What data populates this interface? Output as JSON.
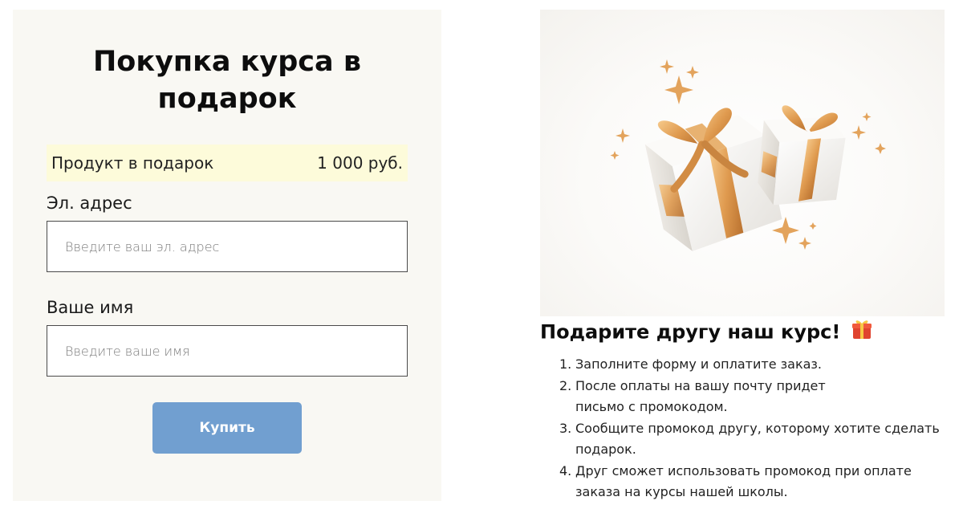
{
  "form": {
    "title": "Покупка курса в подарок",
    "product_label": "Продукт в подарок",
    "product_price": "1 000 руб.",
    "email_label": "Эл. адрес",
    "email_placeholder": "Введите ваш эл. адрес",
    "email_value": "",
    "name_label": "Ваше имя",
    "name_placeholder": "Введите ваше имя",
    "name_value": "",
    "buy_label": "Купить"
  },
  "promo": {
    "heading": "Подарите другу наш курс!",
    "heading_icon": "gift-emoji-icon",
    "image_icon": "gift-boxes-illustration",
    "steps": [
      {
        "num": "1.",
        "text": "Заполните форму и оплатите заказ."
      },
      {
        "num": "2.",
        "text": "После оплаты на вашу почту придет письмо с промокодом."
      },
      {
        "num": "3.",
        "text": "Сообщите промокод другу, которому хотите сделать подарок."
      },
      {
        "num": "4.",
        "text": "Друг сможет использовать промокод при оплате заказа на курсы нашей школы."
      }
    ]
  },
  "colors": {
    "panel_bg": "#f9f8f3",
    "product_row_bg": "#fdfbda",
    "button_bg": "#719fd0",
    "ribbon_gold": "#e0a25a"
  }
}
